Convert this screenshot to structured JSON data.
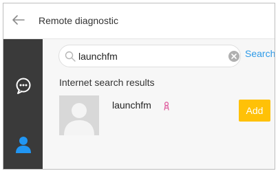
{
  "header": {
    "title": "Remote diagnostic",
    "back_icon": "arrow-left-icon"
  },
  "sidebar": {
    "items": [
      {
        "icon": "chat-bubble-icon",
        "active": false
      },
      {
        "icon": "user-icon",
        "active": true
      }
    ]
  },
  "search": {
    "value": "launchfm",
    "action_label": "Search",
    "icon": "search-icon",
    "clear_icon": "clear-icon"
  },
  "results": {
    "title": "Internet search results",
    "items": [
      {
        "name": "launchfm",
        "gender_icon": "female-icon",
        "action_label": "Add"
      }
    ]
  },
  "colors": {
    "accent": "#2d9ae8",
    "add_button": "#ffc107",
    "sidebar_bg": "#3a3a3a",
    "sidebar_active_icon": "#2196f3",
    "gender_icon": "#e05fa0"
  }
}
